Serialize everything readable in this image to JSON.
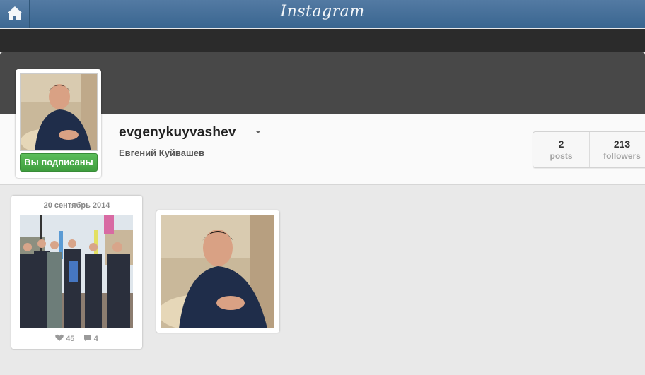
{
  "header": {
    "logo_text": "Instagram",
    "home_icon": "home-icon"
  },
  "profile": {
    "username": "evgenykuyvashev",
    "full_name": "Евгений Куйвашев",
    "follow_button_label": "Вы подписаны",
    "follow_button_color": "#4cae4c"
  },
  "stats": {
    "posts_count": "2",
    "posts_label": "posts",
    "followers_count": "213",
    "followers_label": "followers"
  },
  "posts": [
    {
      "date": "20 сентябрь 2014",
      "likes": "45",
      "comments": "4"
    },
    {}
  ]
}
